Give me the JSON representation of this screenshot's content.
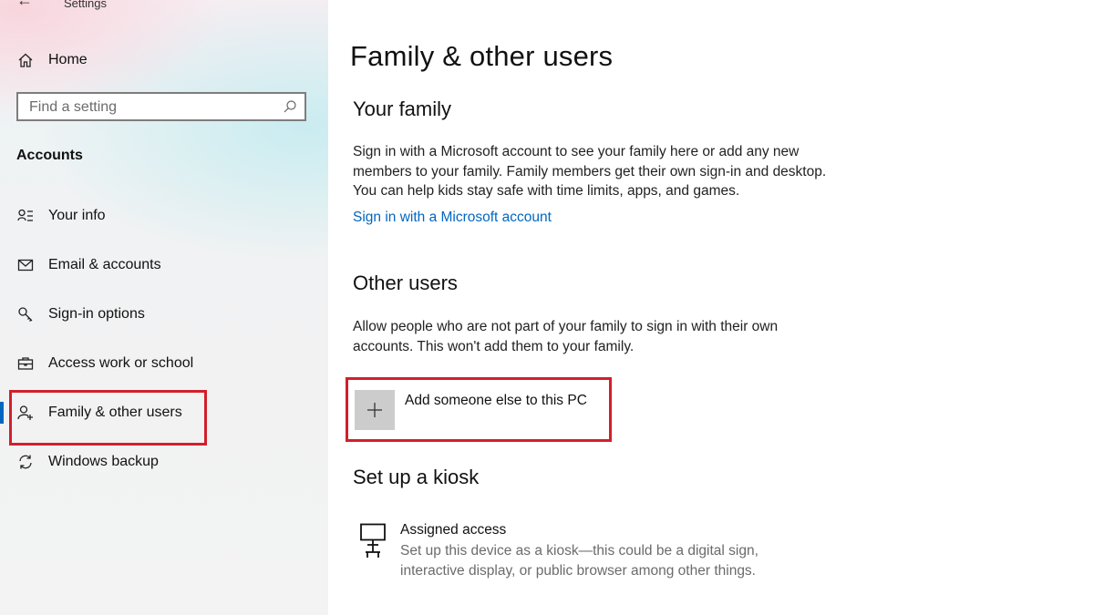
{
  "window": {
    "title": "Settings",
    "back_icon": "back-arrow-icon"
  },
  "sidebar": {
    "home_label": "Home",
    "search_placeholder": "Find a setting",
    "section_label": "Accounts",
    "items": [
      {
        "label": "Your info",
        "icon": "person-list-icon"
      },
      {
        "label": "Email & accounts",
        "icon": "mail-icon"
      },
      {
        "label": "Sign-in options",
        "icon": "key-icon"
      },
      {
        "label": "Access work or school",
        "icon": "briefcase-icon"
      },
      {
        "label": "Family & other users",
        "icon": "person-add-icon",
        "selected": true
      },
      {
        "label": "Windows backup",
        "icon": "sync-icon"
      }
    ],
    "accent_color": "#0067c0",
    "highlight_color": "#d21f2a"
  },
  "main": {
    "title": "Family & other users",
    "family": {
      "heading": "Your family",
      "description": "Sign in with a Microsoft account to see your family here or add any new members to your family. Family members get their own sign-in and desktop. You can help kids stay safe with time limits, apps, and games.",
      "link": "Sign in with a Microsoft account"
    },
    "other_users": {
      "heading": "Other users",
      "description": "Allow people who are not part of your family to sign in with their own accounts. This won't add them to your family.",
      "add_label": "Add someone else to this PC",
      "add_icon": "plus-icon"
    },
    "kiosk": {
      "heading": "Set up a kiosk",
      "title": "Assigned access",
      "description": "Set up this device as a kiosk—this could be a digital sign, interactive display, or public browser among other things.",
      "icon": "kiosk-icon"
    }
  }
}
